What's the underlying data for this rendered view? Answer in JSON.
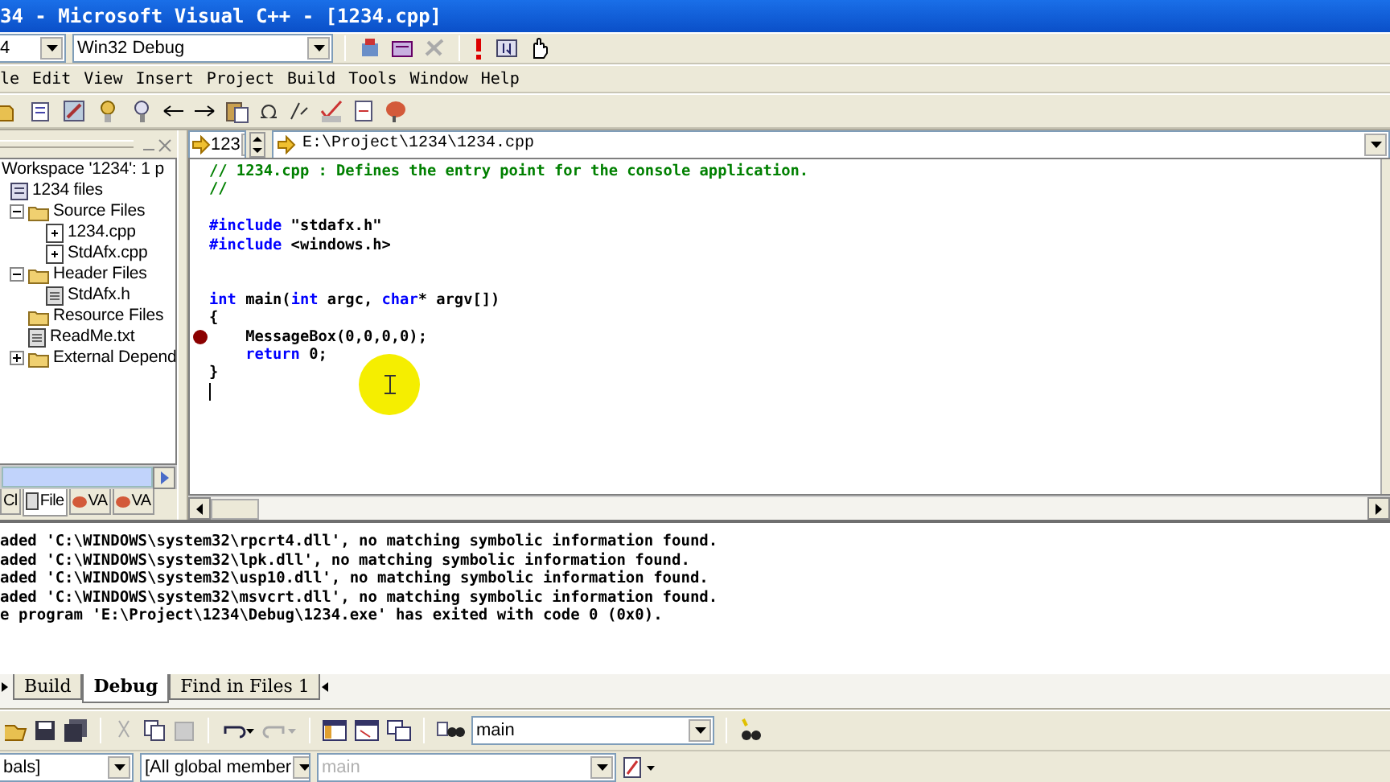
{
  "window": {
    "title": "34 - Microsoft Visual C++ - [1234.cpp]"
  },
  "build_toolbar": {
    "project_combo": "4",
    "config_combo": "Win32 Debug"
  },
  "menu": [
    "le",
    "Edit",
    "View",
    "Insert",
    "Project",
    "Build",
    "Tools",
    "Window",
    "Help"
  ],
  "workspace": {
    "title": "Workspace '1234': 1 p",
    "tree": [
      {
        "label": "1234 files",
        "kind": "project",
        "children": [
          {
            "label": "Source Files",
            "kind": "folder",
            "expanded": true,
            "children": [
              {
                "label": "1234.cpp",
                "kind": "source"
              },
              {
                "label": "StdAfx.cpp",
                "kind": "source"
              }
            ]
          },
          {
            "label": "Header Files",
            "kind": "folder",
            "expanded": true,
            "children": [
              {
                "label": "StdAfx.h",
                "kind": "header"
              }
            ]
          },
          {
            "label": "Resource Files",
            "kind": "folder"
          },
          {
            "label": "ReadMe.txt",
            "kind": "header"
          },
          {
            "label": "External Depend",
            "kind": "folder",
            "expanded": false
          }
        ]
      }
    ],
    "tabs": [
      {
        "label": "Cl",
        "selected": false
      },
      {
        "label": "File",
        "selected": true
      },
      {
        "label": "VA",
        "selected": false
      },
      {
        "label": "VA",
        "selected": false
      }
    ]
  },
  "editor": {
    "function_combo": "123",
    "file_path": "E:\\Project\\1234\\1234.cpp",
    "lines": [
      {
        "breakpoint": false,
        "caret": false,
        "tokens": [
          {
            "kind": "comment",
            "text": "// 1234.cpp : Defines the entry point for the console application."
          }
        ]
      },
      {
        "breakpoint": false,
        "caret": false,
        "tokens": [
          {
            "kind": "comment",
            "text": "//"
          }
        ]
      },
      {
        "breakpoint": false,
        "caret": false
      },
      {
        "breakpoint": false,
        "caret": false,
        "tokens": [
          {
            "kind": "keyword",
            "text": "#include"
          },
          {
            "kind": "plain",
            "text": " \"stdafx.h\""
          }
        ]
      },
      {
        "breakpoint": false,
        "caret": false,
        "tokens": [
          {
            "kind": "keyword",
            "text": "#include"
          },
          {
            "kind": "plain",
            "text": " <windows.h>"
          }
        ]
      },
      {
        "breakpoint": false,
        "caret": false
      },
      {
        "breakpoint": false,
        "caret": false
      },
      {
        "breakpoint": false,
        "caret": false,
        "tokens": [
          {
            "kind": "keyword",
            "text": "int"
          },
          {
            "kind": "plain",
            "text": " main("
          },
          {
            "kind": "keyword",
            "text": "int"
          },
          {
            "kind": "plain",
            "text": " argc, "
          },
          {
            "kind": "keyword",
            "text": "char"
          },
          {
            "kind": "plain",
            "text": "* argv[])"
          }
        ]
      },
      {
        "breakpoint": false,
        "caret": false,
        "tokens": [
          {
            "kind": "plain",
            "text": "{"
          }
        ]
      },
      {
        "breakpoint": true,
        "caret": false,
        "tokens": [
          {
            "kind": "plain",
            "text": "    MessageBox(0,0,0,0);"
          }
        ]
      },
      {
        "breakpoint": false,
        "caret": false,
        "tokens": [
          {
            "kind": "keyword",
            "text": "    return"
          },
          {
            "kind": "plain",
            "text": " 0;"
          }
        ]
      },
      {
        "breakpoint": false,
        "caret": false,
        "tokens": [
          {
            "kind": "plain",
            "text": "}"
          }
        ]
      },
      {
        "breakpoint": false,
        "caret": true
      }
    ]
  },
  "output": {
    "lines": [
      "aded 'C:\\WINDOWS\\system32\\rpcrt4.dll', no matching symbolic information found.",
      "aded 'C:\\WINDOWS\\system32\\lpk.dll', no matching symbolic information found.",
      "aded 'C:\\WINDOWS\\system32\\usp10.dll', no matching symbolic information found.",
      "aded 'C:\\WINDOWS\\system32\\msvcrt.dll', no matching symbolic information found.",
      "e program 'E:\\Project\\1234\\Debug\\1234.exe' has exited with code 0 (0x0)."
    ]
  },
  "output_tabs": [
    {
      "label": "Build",
      "selected": false
    },
    {
      "label": "Debug",
      "selected": true
    },
    {
      "label": "Find in Files 1",
      "selected": false
    }
  ],
  "standard_toolbar": {
    "find_combo": "main"
  },
  "wizard_bar": {
    "class_combo": "bals]",
    "filter_combo": "[All global member",
    "members_combo": {
      "value": "main",
      "disabled": true
    }
  }
}
